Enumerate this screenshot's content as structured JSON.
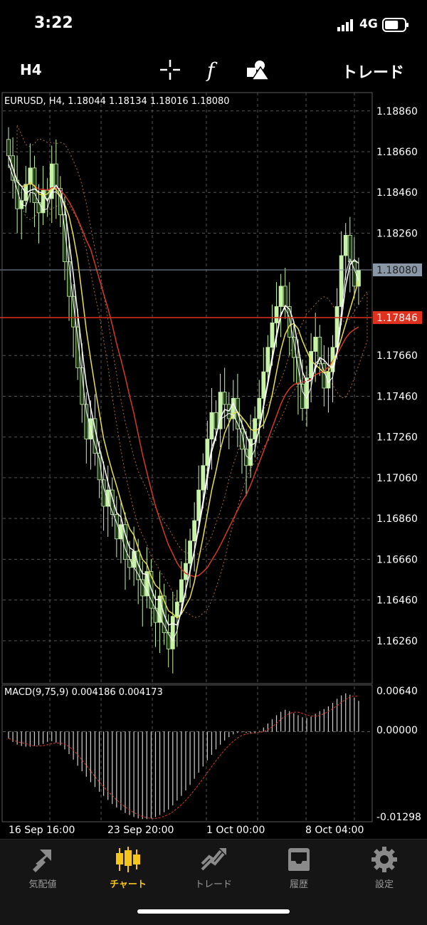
{
  "status_bar": {
    "time": "3:22",
    "network": "4G",
    "battery_level": 0.7
  },
  "toolbar": {
    "timeframe": "H4",
    "trade_label": "トレード",
    "icons": [
      "crosshair-icon",
      "function-icon",
      "objects-icon"
    ]
  },
  "chart_header": {
    "symbol_line": "EURUSD, H4, 1.18044 1.18134 1.18016 1.18080"
  },
  "price_axis": {
    "ticks": [
      "1.18860",
      "1.18660",
      "1.18460",
      "1.18260",
      "1.18080",
      "1.17846",
      "1.17660",
      "1.17460",
      "1.17260",
      "1.17060",
      "1.16860",
      "1.16660",
      "1.16460",
      "1.16260"
    ],
    "current_price": "1.18080",
    "current_price_color": "#8a97a6",
    "red_line_price": "1.17846",
    "red_line_color": "#e0301e"
  },
  "macd_panel": {
    "label": "MACD(9,75,9) 0.004186 0.004173",
    "ticks": [
      "0.00640",
      "0.00000",
      "-0.01298"
    ]
  },
  "time_axis": {
    "labels": [
      "16 Sep 16:00",
      "23 Sep 20:00",
      "1 Oct 00:00",
      "8 Oct 04:00"
    ]
  },
  "chart_data": {
    "type": "candlestick",
    "symbol": "EURUSD",
    "timeframe": "H4",
    "ylim": [
      1.1605,
      1.1895
    ],
    "close_path": [
      1.1864,
      1.1852,
      1.1838,
      1.1842,
      1.185,
      1.1858,
      1.1841,
      1.1836,
      1.1847,
      1.1843,
      1.186,
      1.1848,
      1.1835,
      1.1812,
      1.1795,
      1.178,
      1.176,
      1.1742,
      1.1725,
      1.1735,
      1.1718,
      1.1705,
      1.1692,
      1.17,
      1.1688,
      1.1676,
      1.1683,
      1.1666,
      1.1662,
      1.167,
      1.1656,
      1.1648,
      1.166,
      1.1642,
      1.1635,
      1.1648,
      1.163,
      1.1622,
      1.1638,
      1.1645,
      1.1656,
      1.1664,
      1.1675,
      1.1685,
      1.17,
      1.1712,
      1.1725,
      1.1738,
      1.173,
      1.1748,
      1.1742,
      1.1735,
      1.1745,
      1.173,
      1.172,
      1.1712,
      1.1725,
      1.1735,
      1.1745,
      1.1758,
      1.177,
      1.1782,
      1.179,
      1.18,
      1.179,
      1.1775,
      1.1765,
      1.1752,
      1.174,
      1.1755,
      1.1768,
      1.1775,
      1.1762,
      1.175,
      1.1758,
      1.177,
      1.179,
      1.1815,
      1.1825,
      1.1812,
      1.18,
      1.1808
    ],
    "macd_zero_ratio": 0.33,
    "macd_min": -0.01298,
    "macd_max": 0.0064,
    "macd_histogram": [
      -0.001,
      -0.0015,
      -0.0019,
      -0.0021,
      -0.0022,
      -0.0022,
      -0.0021,
      -0.002,
      -0.0018,
      -0.0015,
      -0.0014,
      -0.0016,
      -0.002,
      -0.0026,
      -0.0033,
      -0.0041,
      -0.005,
      -0.0058,
      -0.0066,
      -0.0074,
      -0.0081,
      -0.0088,
      -0.0094,
      -0.01,
      -0.0106,
      -0.0111,
      -0.0115,
      -0.0119,
      -0.0122,
      -0.0125,
      -0.0127,
      -0.0128,
      -0.0128,
      -0.0127,
      -0.0125,
      -0.0122,
      -0.0118,
      -0.0114,
      -0.0108,
      -0.0101,
      -0.0094,
      -0.0086,
      -0.0078,
      -0.0069,
      -0.006,
      -0.0051,
      -0.0042,
      -0.0034,
      -0.0026,
      -0.0019,
      -0.0013,
      -0.0008,
      -0.0004,
      -0.0002,
      -0.0001,
      -0.0002,
      -0.0003,
      -0.0002,
      0.0001,
      0.0006,
      0.0012,
      0.0018,
      0.0024,
      0.0029,
      0.0032,
      0.003,
      0.0027,
      0.0024,
      0.0021,
      0.002,
      0.0022,
      0.0026,
      0.003,
      0.0033,
      0.0037,
      0.0042,
      0.0048,
      0.0053,
      0.0056,
      0.0054,
      0.005,
      0.0045
    ]
  },
  "bottom_tabs": [
    {
      "label": "気配値",
      "icon": "quotes-icon",
      "active": false
    },
    {
      "label": "チャート",
      "icon": "chart-icon",
      "active": true
    },
    {
      "label": "トレード",
      "icon": "trade-icon",
      "active": false
    },
    {
      "label": "履歴",
      "icon": "history-icon",
      "active": false
    },
    {
      "label": "設定",
      "icon": "settings-icon",
      "active": false
    }
  ],
  "colors": {
    "active": "#f5c518",
    "inactive": "#9a9a9a",
    "candle_up": "#c6f3a8",
    "candle_down": "#1e3a16",
    "ma_red": "#d23a2a",
    "ma_yellow": "#e8e050"
  }
}
